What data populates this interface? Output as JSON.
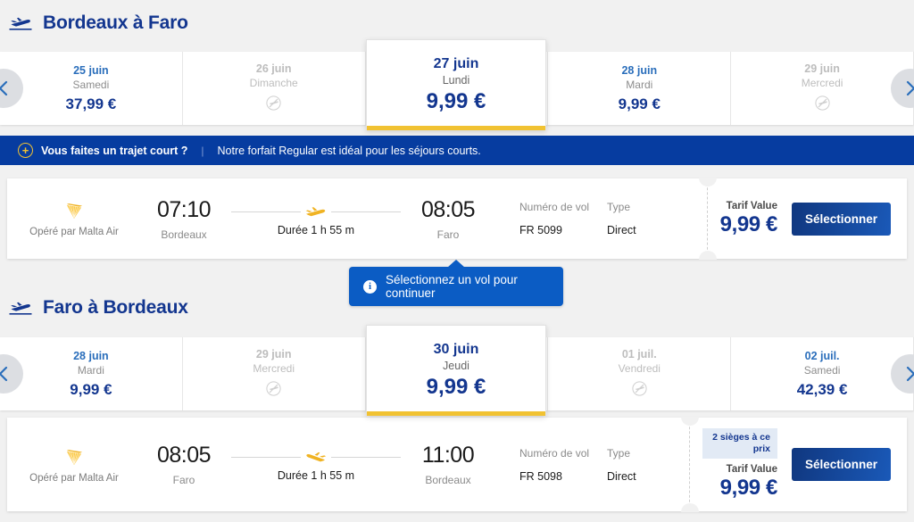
{
  "outbound": {
    "header": {
      "title": "Bordeaux à Faro",
      "icon": "takeoff-plane-icon"
    },
    "nav": {
      "prev": "‹",
      "next": "›"
    },
    "dates": [
      {
        "date": "25 juin",
        "day": "Samedi",
        "price": "37,99 €",
        "available": true,
        "selected": false
      },
      {
        "date": "26 juin",
        "day": "Dimanche",
        "price": "",
        "available": false,
        "selected": false
      },
      {
        "date": "27 juin",
        "day": "Lundi",
        "price": "9,99 €",
        "available": true,
        "selected": true
      },
      {
        "date": "28 juin",
        "day": "Mardi",
        "price": "9,99 €",
        "available": true,
        "selected": false
      },
      {
        "date": "29 juin",
        "day": "Mercredi",
        "price": "",
        "available": false,
        "selected": false
      }
    ],
    "flight": {
      "operator": "Opéré par Malta Air",
      "depart_time": "07:10",
      "depart_city": "Bordeaux",
      "duration": "Durée 1 h 55 m",
      "arrive_time": "08:05",
      "arrive_city": "Faro",
      "flight_number_label": "Numéro de vol",
      "flight_number": "FR 5099",
      "type_label": "Type",
      "type_value": "Direct",
      "seats_badge": "",
      "fare_label": "Tarif Value",
      "fare_price": "9,99 €",
      "select_label": "Sélectionner"
    }
  },
  "promo": {
    "plus_icon": "+",
    "headline": "Vous faites un trajet court ?",
    "separator": "|",
    "text": "Notre forfait Regular est idéal pour les séjours courts."
  },
  "tooltip": {
    "info_icon": "i",
    "text": "Sélectionnez un vol pour continuer"
  },
  "inbound": {
    "header": {
      "title": "Faro à Bordeaux",
      "icon": "takeoff-plane-icon"
    },
    "nav": {
      "prev": "‹",
      "next": "›"
    },
    "dates": [
      {
        "date": "28 juin",
        "day": "Mardi",
        "price": "9,99 €",
        "available": true,
        "selected": false
      },
      {
        "date": "29 juin",
        "day": "Mercredi",
        "price": "",
        "available": false,
        "selected": false
      },
      {
        "date": "30 juin",
        "day": "Jeudi",
        "price": "9,99 €",
        "available": true,
        "selected": true
      },
      {
        "date": "01 juil.",
        "day": "Vendredi",
        "price": "",
        "available": false,
        "selected": false
      },
      {
        "date": "02 juil.",
        "day": "Samedi",
        "price": "42,39 €",
        "available": true,
        "selected": false
      }
    ],
    "flight": {
      "operator": "Opéré par Malta Air",
      "depart_time": "08:05",
      "depart_city": "Faro",
      "duration": "Durée 1 h 55 m",
      "arrive_time": "11:00",
      "arrive_city": "Bordeaux",
      "flight_number_label": "Numéro de vol",
      "flight_number": "FR 5098",
      "type_label": "Type",
      "type_value": "Direct",
      "seats_badge": "2 sièges à ce prix",
      "fare_label": "Tarif Value",
      "fare_price": "9,99 €",
      "select_label": "Sélectionner"
    }
  },
  "colors": {
    "brand_navy": "#13368f",
    "brand_blue": "#0b5cc4",
    "promo_blue": "#063ca0",
    "accent_yellow": "#f1c232",
    "page_bg": "#f1f1f1"
  }
}
